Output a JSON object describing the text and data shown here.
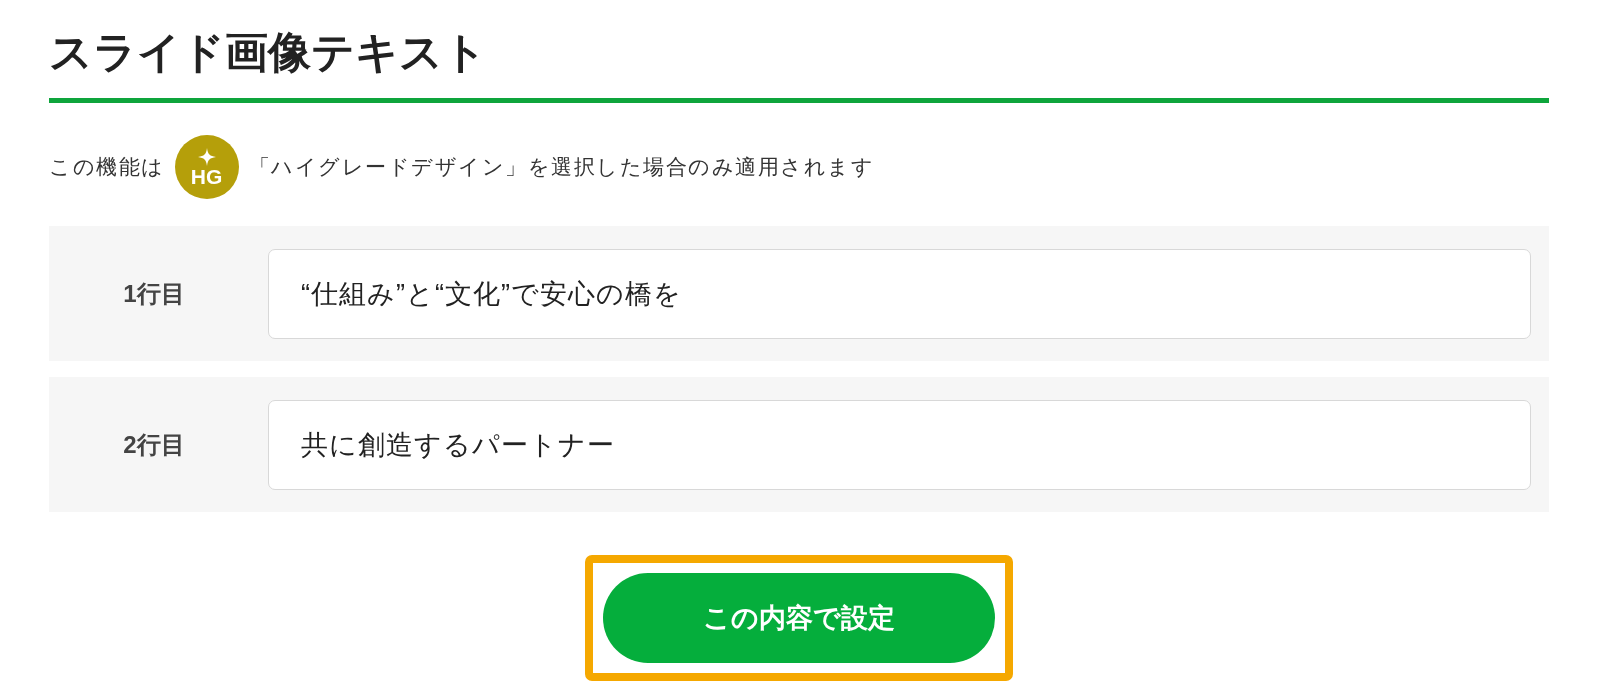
{
  "heading": "スライド画像テキスト",
  "notice": {
    "before": "この機能は",
    "badge": "HG",
    "after": "「ハイグレードデザイン」を選択した場合のみ適用されます"
  },
  "fields": [
    {
      "label": "1行目",
      "value": "“仕組み”と“文化”で安心の橋を"
    },
    {
      "label": "2行目",
      "value": "共に創造するパートナー"
    }
  ],
  "submit": {
    "label": "この内容で設定",
    "highlighted": true
  }
}
